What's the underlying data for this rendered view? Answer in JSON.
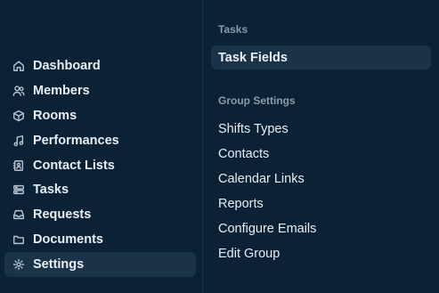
{
  "sidebar": {
    "items": [
      {
        "label": "Dashboard",
        "icon": "home-icon"
      },
      {
        "label": "Members",
        "icon": "users-icon"
      },
      {
        "label": "Rooms",
        "icon": "cube-icon"
      },
      {
        "label": "Performances",
        "icon": "music-icon"
      },
      {
        "label": "Contact Lists",
        "icon": "contact-icon"
      },
      {
        "label": "Tasks",
        "icon": "tasks-icon"
      },
      {
        "label": "Requests",
        "icon": "inbox-icon"
      },
      {
        "label": "Documents",
        "icon": "folder-icon"
      },
      {
        "label": "Settings",
        "icon": "gear-icon"
      }
    ],
    "active": "Settings"
  },
  "panel": {
    "tasks_header": "Tasks",
    "task_fields": "Task Fields",
    "group_header": "Group Settings",
    "group_items": [
      "Shifts Types",
      "Contacts",
      "Calendar Links",
      "Reports",
      "Configure Emails",
      "Edit Group"
    ]
  },
  "colors": {
    "background": "#0b2236",
    "active_bg": "#1a3349",
    "text": "#e8eef5",
    "muted": "#8d9aa8"
  }
}
